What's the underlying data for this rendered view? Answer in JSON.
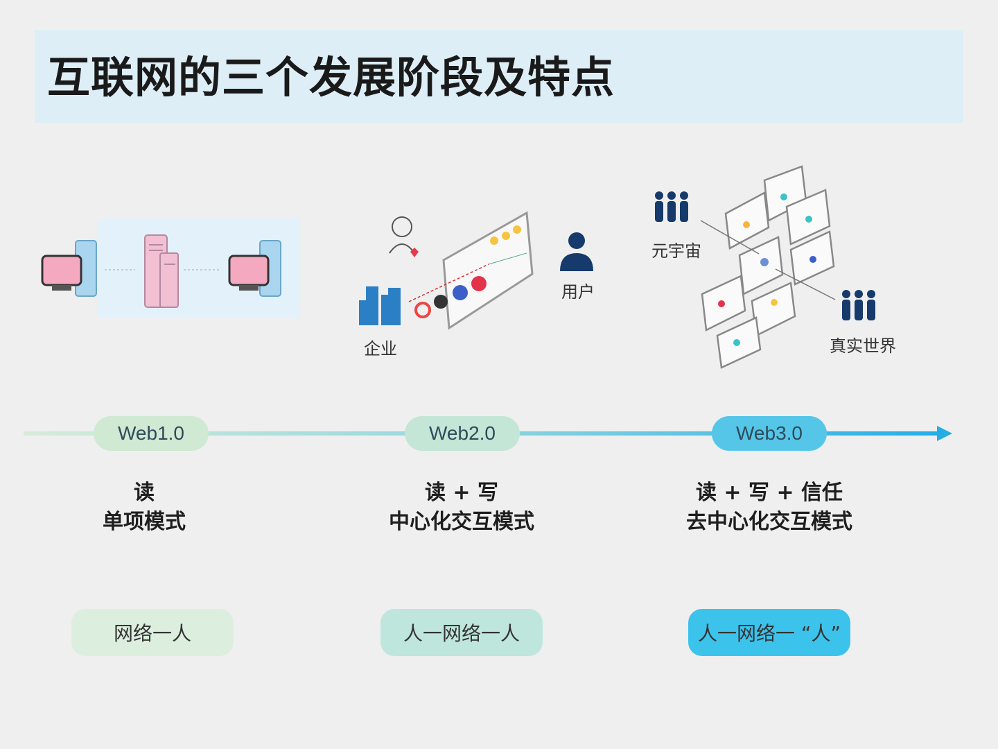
{
  "title": "互联网的三个发展阶段及特点",
  "illustrations": {
    "web2": {
      "enterprise_label": "企业",
      "user_label": "用户"
    },
    "web3": {
      "metaverse_label": "元宇宙",
      "real_world_label": "真实世界"
    }
  },
  "stages": [
    {
      "name": "Web1.0",
      "line1": "读",
      "line2": "单项模式",
      "relation": "网络一人",
      "color": "#dcefdf",
      "node_color": "#cfe9d3"
    },
    {
      "name": "Web2.0",
      "line1": "读 + 写",
      "line2": "中心化交互模式",
      "relation": "人一网络一人",
      "color": "#bfe6dd",
      "node_color": "#c3e6d6"
    },
    {
      "name": "Web3.0",
      "line1": "读 + 写 + 信任",
      "line2": "去中心化交互模式",
      "relation": "人一网络一 “人”",
      "color": "#3cc3eb",
      "node_color": "#55c6e8"
    }
  ],
  "timeline": {
    "start_color": "#d6ecd9",
    "mid_color": "#8fd6de",
    "end_color": "#23aee8"
  }
}
